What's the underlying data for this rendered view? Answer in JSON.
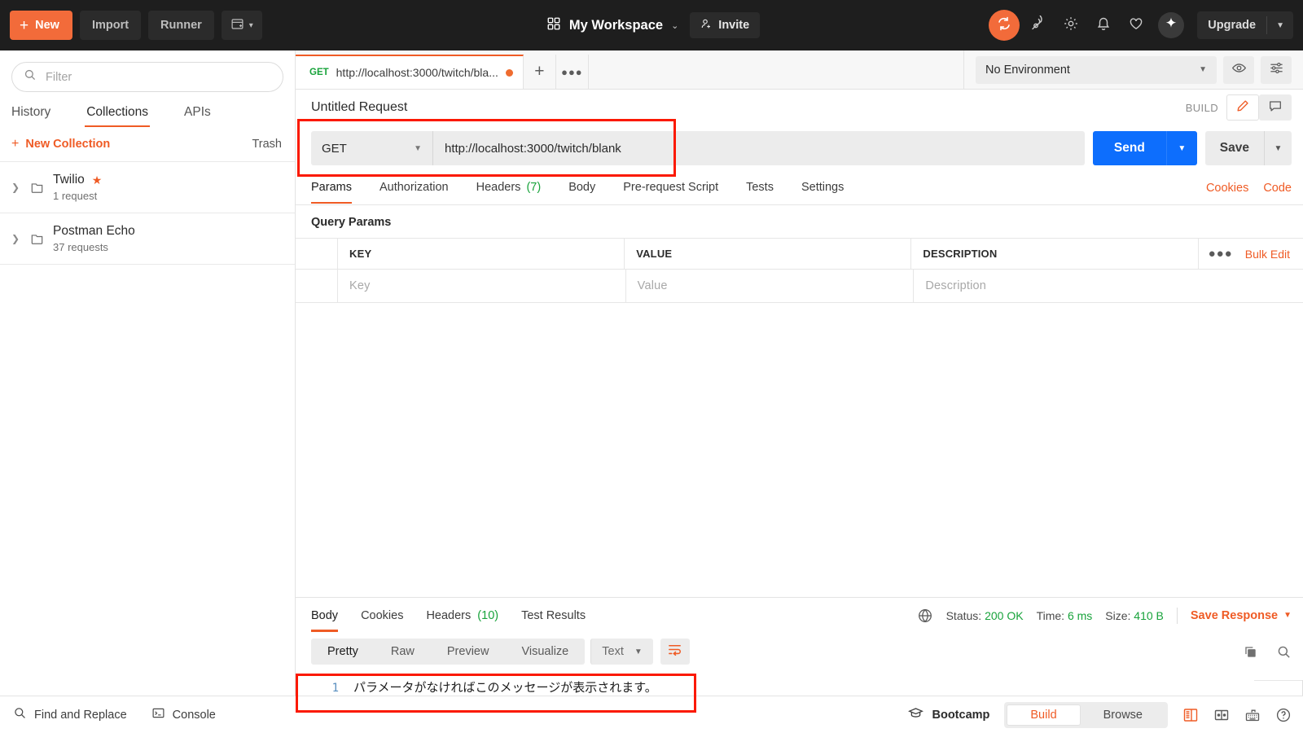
{
  "topbar": {
    "new_label": "New",
    "import_label": "Import",
    "runner_label": "Runner",
    "workspace_title": "My Workspace",
    "invite_label": "Invite",
    "upgrade_label": "Upgrade",
    "icons": {
      "new_plus": "+",
      "grid": "grid-icon",
      "sync": "sync-icon",
      "satellite": "satellite-icon",
      "gear": "gear-icon",
      "bell": "bell-icon",
      "heart": "heart-icon",
      "sparkle": "sparkle-icon"
    },
    "accent": "#f26b3a",
    "background": "#1e1e1e"
  },
  "sidebar": {
    "filter_placeholder": "Filter",
    "filter_value": "",
    "tabs": [
      {
        "label": "History",
        "active": false
      },
      {
        "label": "Collections",
        "active": true
      },
      {
        "label": "APIs",
        "active": false
      }
    ],
    "new_collection_label": "New Collection",
    "new_collection_plus": "+",
    "trash_label": "Trash",
    "collections": [
      {
        "name": "Twilio",
        "count": "1 request",
        "starred": true,
        "star": "★"
      },
      {
        "name": "Postman Echo",
        "count": "37 requests",
        "starred": false,
        "star": ""
      }
    ]
  },
  "tabbar": {
    "request_tab": {
      "method": "GET",
      "url": "http://localhost:3000/twitch/bla...",
      "unsaved": true
    },
    "plus_label": "+",
    "dots_label": "●●●"
  },
  "environment": {
    "selected": "No Environment",
    "eye_icon": "eye-icon",
    "settings_icon": "sliders-icon"
  },
  "request": {
    "title": "Untitled Request",
    "build_label": "BUILD",
    "method": "GET",
    "url": "http://localhost:3000/twitch/blank",
    "send_label": "Send",
    "save_label": "Save",
    "tabs": [
      {
        "label": "Params",
        "count": "",
        "active": true
      },
      {
        "label": "Authorization",
        "count": "",
        "active": false
      },
      {
        "label": "Headers",
        "count": "(7)",
        "active": false
      },
      {
        "label": "Body",
        "count": "",
        "active": false
      },
      {
        "label": "Pre-request Script",
        "count": "",
        "active": false
      },
      {
        "label": "Tests",
        "count": "",
        "active": false
      },
      {
        "label": "Settings",
        "count": "",
        "active": false
      }
    ],
    "links": [
      "Cookies",
      "Code"
    ],
    "query_params_label": "Query Params",
    "table": {
      "headers": [
        "KEY",
        "VALUE",
        "DESCRIPTION"
      ],
      "dots_label": "●●●",
      "bulk_edit_label": "Bulk Edit",
      "rows": [
        {
          "key": "Key",
          "value": "Value",
          "description": "Description"
        }
      ]
    }
  },
  "response": {
    "tabs": [
      {
        "label": "Body",
        "count": "",
        "active": true
      },
      {
        "label": "Cookies",
        "count": "",
        "active": false
      },
      {
        "label": "Headers",
        "count": "(10)",
        "active": false
      },
      {
        "label": "Test Results",
        "count": "",
        "active": false
      }
    ],
    "status_label": "Status:",
    "status_value": "200 OK",
    "time_label": "Time:",
    "time_value": "6 ms",
    "size_label": "Size:",
    "size_value": "410 B",
    "save_response_label": "Save Response",
    "view_modes": [
      {
        "label": "Pretty",
        "active": true
      },
      {
        "label": "Raw",
        "active": false
      },
      {
        "label": "Preview",
        "active": false
      },
      {
        "label": "Visualize",
        "active": false
      }
    ],
    "content_type": "Text",
    "wrap_icon": "word-wrap-icon",
    "copy_icon": "copy-icon",
    "search_icon": "search-icon",
    "body_lines": [
      {
        "no": "1",
        "text": "パラメータがなければこのメッセージが表示されます。"
      }
    ]
  },
  "footer": {
    "find_replace_label": "Find and Replace",
    "console_label": "Console",
    "bootcamp_label": "Bootcamp",
    "view_toggle": [
      {
        "label": "Build",
        "active": true
      },
      {
        "label": "Browse",
        "active": false
      }
    ],
    "icons": {
      "layout": "two-pane-layout-icon",
      "split": "split-pane-icon",
      "keyboard": "keyboard-shortcuts-icon",
      "help": "help-icon"
    }
  },
  "highlights": {
    "color": "#fb1900"
  }
}
